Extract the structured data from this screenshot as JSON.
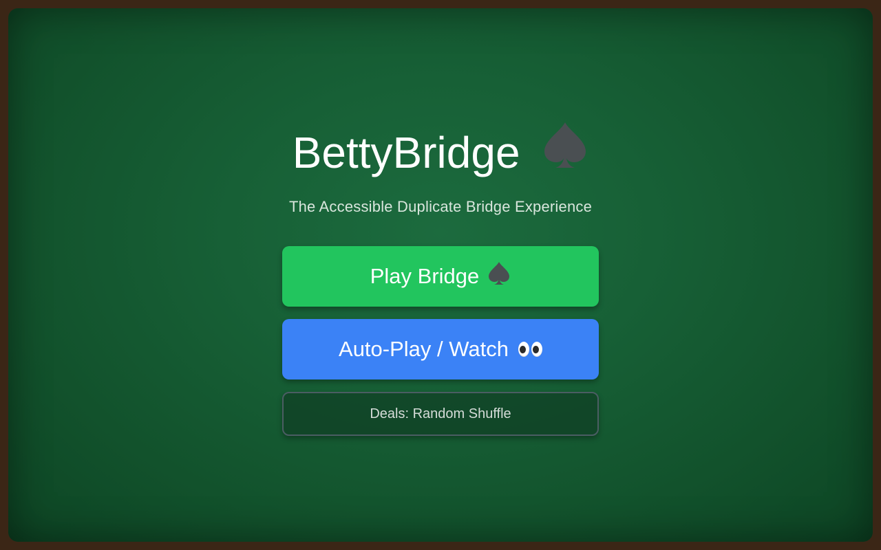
{
  "app": {
    "title": "BettyBridge",
    "subtitle": "The Accessible Duplicate Bridge Experience"
  },
  "menu": {
    "play_label": "Play Bridge",
    "auto_label": "Auto-Play / Watch",
    "deals_label": "Deals: Random Shuffle"
  },
  "icons": {
    "title_icon": "spade-icon",
    "play_icon": "spade-icon",
    "auto_icon": "eyes-icon"
  },
  "colors": {
    "felt": "#176036",
    "frame": "#3b2616",
    "play_button": "#22c55e",
    "auto_button": "#3b82f6",
    "spade": "#4a4f52"
  }
}
